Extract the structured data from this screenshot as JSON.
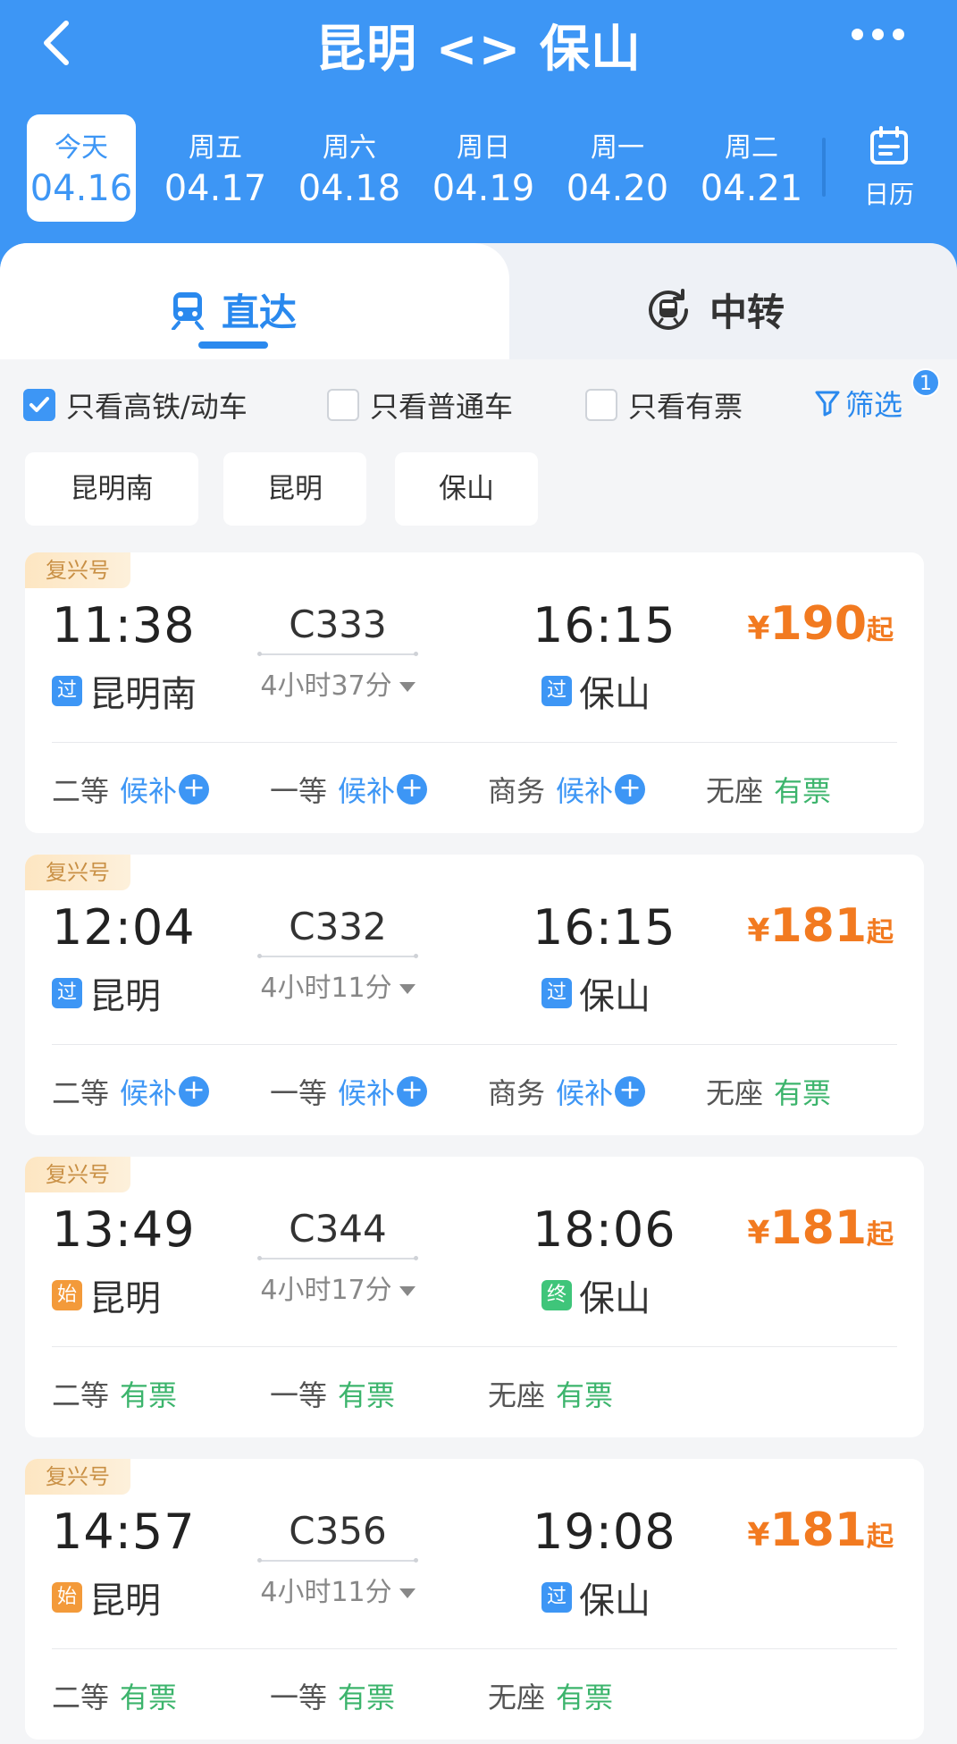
{
  "header": {
    "title": "昆明 <> 保山",
    "colors": {
      "primary": "#3d96f5",
      "price": "#f27a20",
      "available": "#3cb46c"
    }
  },
  "dates": [
    {
      "weekday": "今天",
      "date": "04.16",
      "active": true
    },
    {
      "weekday": "周五",
      "date": "04.17",
      "active": false
    },
    {
      "weekday": "周六",
      "date": "04.18",
      "active": false
    },
    {
      "weekday": "周日",
      "date": "04.19",
      "active": false
    },
    {
      "weekday": "周一",
      "date": "04.20",
      "active": false
    },
    {
      "weekday": "周二",
      "date": "04.21",
      "active": false
    }
  ],
  "calendar_label": "日历",
  "tabs": [
    {
      "label": "直达",
      "icon": "train-icon",
      "active": true
    },
    {
      "label": "中转",
      "icon": "transfer-train-icon",
      "active": false
    }
  ],
  "filters": {
    "high_speed_only": {
      "label": "只看高铁/动车",
      "checked": true
    },
    "regular_only": {
      "label": "只看普通车",
      "checked": false
    },
    "available_only": {
      "label": "只看有票",
      "checked": false
    },
    "filter_label": "筛选",
    "filter_count": "1"
  },
  "stations": [
    "昆明南",
    "昆明",
    "保山"
  ],
  "trains": [
    {
      "brand": "复兴号",
      "dep_time": "11:38",
      "train_no": "C333",
      "duration": "4小时37分",
      "arr_time": "16:15",
      "dep_tag": "过",
      "dep_station": "昆明南",
      "arr_tag": "过",
      "arr_station": "保山",
      "price_currency": "¥",
      "price": "190",
      "price_suffix": "起",
      "seats": [
        {
          "class": "二等",
          "status": "候补",
          "type": "wait"
        },
        {
          "class": "一等",
          "status": "候补",
          "type": "wait"
        },
        {
          "class": "商务",
          "status": "候补",
          "type": "wait"
        },
        {
          "class": "无座",
          "status": "有票",
          "type": "ok"
        }
      ]
    },
    {
      "brand": "复兴号",
      "dep_time": "12:04",
      "train_no": "C332",
      "duration": "4小时11分",
      "arr_time": "16:15",
      "dep_tag": "过",
      "dep_station": "昆明",
      "arr_tag": "过",
      "arr_station": "保山",
      "price_currency": "¥",
      "price": "181",
      "price_suffix": "起",
      "seats": [
        {
          "class": "二等",
          "status": "候补",
          "type": "wait"
        },
        {
          "class": "一等",
          "status": "候补",
          "type": "wait"
        },
        {
          "class": "商务",
          "status": "候补",
          "type": "wait"
        },
        {
          "class": "无座",
          "status": "有票",
          "type": "ok"
        }
      ]
    },
    {
      "brand": "复兴号",
      "dep_time": "13:49",
      "train_no": "C344",
      "duration": "4小时17分",
      "arr_time": "18:06",
      "dep_tag": "始",
      "dep_station": "昆明",
      "arr_tag": "终",
      "arr_station": "保山",
      "price_currency": "¥",
      "price": "181",
      "price_suffix": "起",
      "seats": [
        {
          "class": "二等",
          "status": "有票",
          "type": "ok"
        },
        {
          "class": "一等",
          "status": "有票",
          "type": "ok"
        },
        {
          "class": "无座",
          "status": "有票",
          "type": "ok"
        }
      ]
    },
    {
      "brand": "复兴号",
      "dep_time": "14:57",
      "train_no": "C356",
      "duration": "4小时11分",
      "arr_time": "19:08",
      "dep_tag": "始",
      "dep_station": "昆明",
      "arr_tag": "过",
      "arr_station": "保山",
      "price_currency": "¥",
      "price": "181",
      "price_suffix": "起",
      "seats": [
        {
          "class": "二等",
          "status": "有票",
          "type": "ok"
        },
        {
          "class": "一等",
          "status": "有票",
          "type": "ok"
        },
        {
          "class": "无座",
          "status": "有票",
          "type": "ok"
        }
      ]
    }
  ]
}
